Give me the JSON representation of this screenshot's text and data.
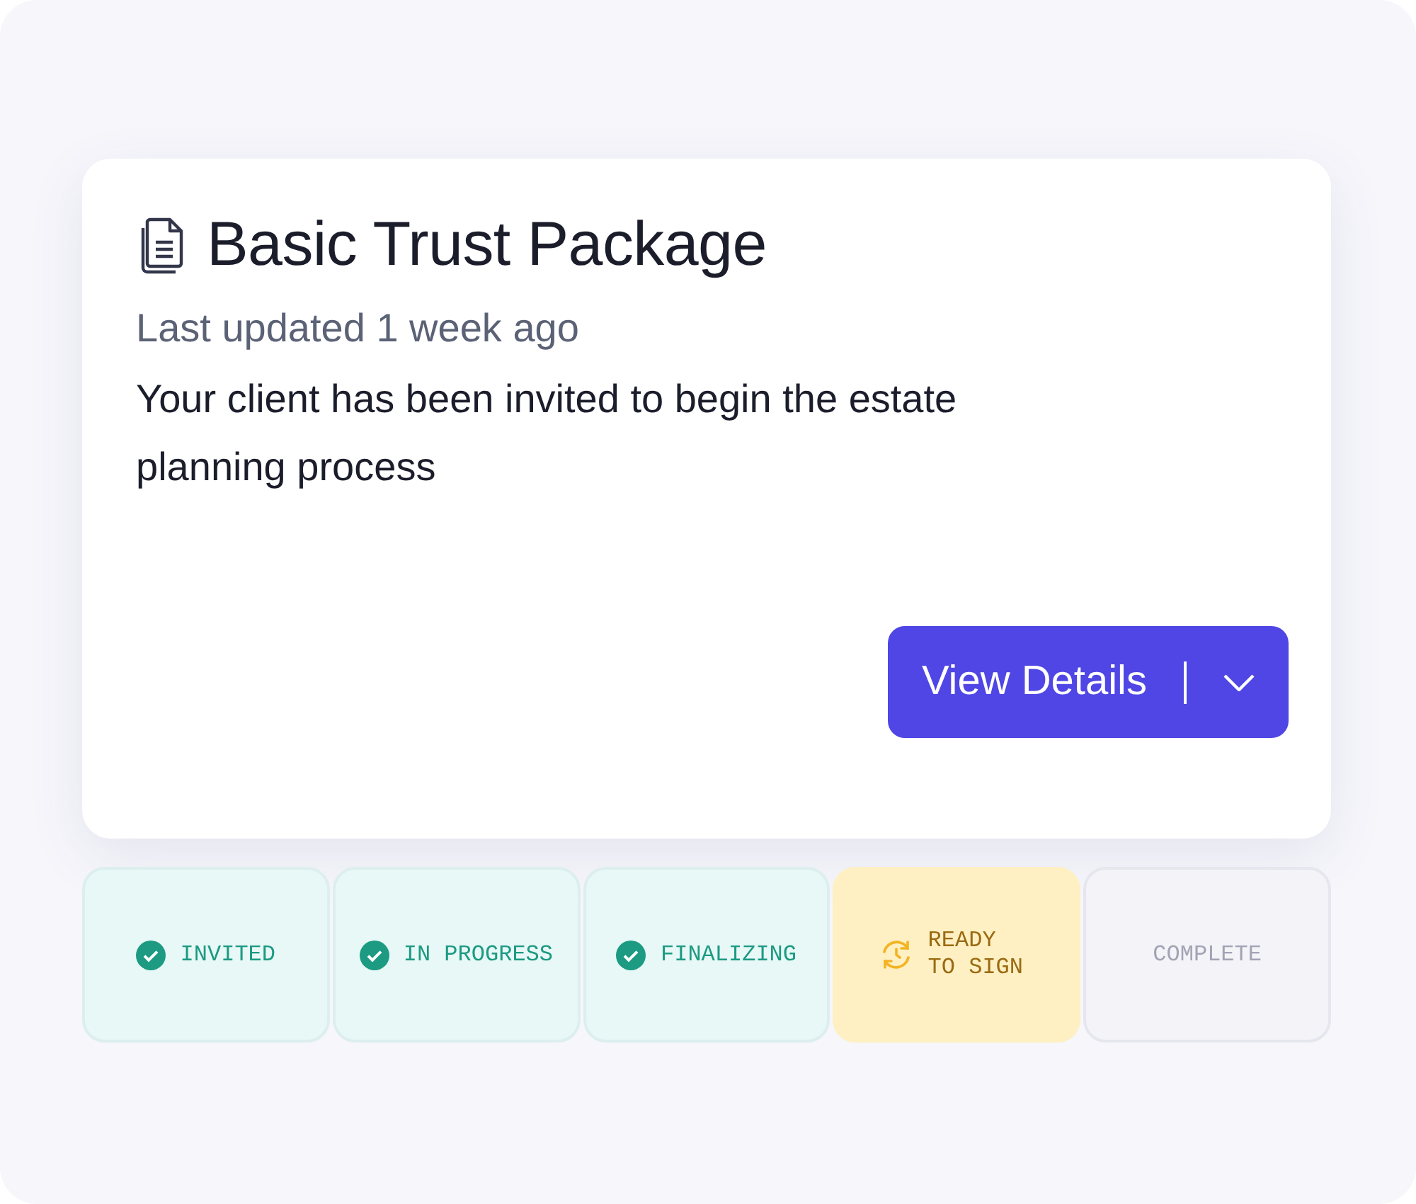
{
  "card": {
    "title": "Basic Trust Package",
    "updated": "Last updated 1 week ago",
    "message": "Your client has been invited to begin the estate planning process",
    "button": {
      "label": "View Details"
    }
  },
  "steps": [
    {
      "label": "INVITED",
      "kind": "done"
    },
    {
      "label": "IN PROGRESS",
      "kind": "done"
    },
    {
      "label": "FINALIZING",
      "kind": "done"
    },
    {
      "label": "READY TO SIGN",
      "kind": "current"
    },
    {
      "label": "COMPLETE",
      "kind": "pending"
    }
  ]
}
